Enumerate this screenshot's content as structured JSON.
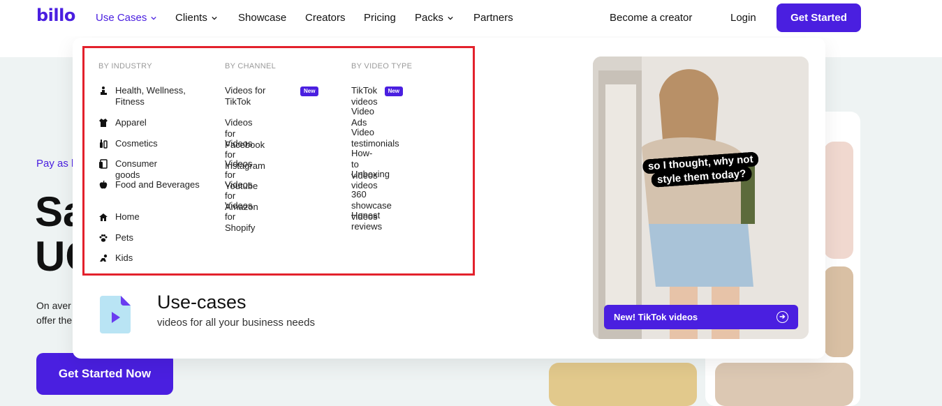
{
  "brand": {
    "logo": "billo",
    "accent": "#4a1fe0"
  },
  "nav": {
    "items": [
      {
        "label": "Use Cases",
        "dropdown": true,
        "active": true
      },
      {
        "label": "Clients",
        "dropdown": true
      },
      {
        "label": "Showcase"
      },
      {
        "label": "Creators"
      },
      {
        "label": "Pricing"
      },
      {
        "label": "Packs",
        "dropdown": true
      },
      {
        "label": "Partners"
      }
    ],
    "become_creator": "Become a creator",
    "login": "Login",
    "get_started": "Get Started"
  },
  "hero": {
    "kicker": "Pay as l",
    "title_line1": "Sa",
    "title_line2": "UC",
    "desc_line1": "On aver",
    "desc_line2": "offer the",
    "cta": "Get Started Now"
  },
  "dropdown": {
    "by_industry": {
      "heading": "BY INDUSTRY",
      "items": [
        {
          "label": "Health, Wellness, Fitness",
          "icon": "fitness-icon"
        },
        {
          "label": "Apparel",
          "icon": "apparel-icon"
        },
        {
          "label": "Cosmetics",
          "icon": "cosmetics-icon"
        },
        {
          "label": "Consumer goods",
          "icon": "consumer-goods-icon"
        },
        {
          "label": "Food and Beverages",
          "icon": "apple-icon"
        },
        {
          "label": "Home",
          "icon": "home-icon"
        },
        {
          "label": "Pets",
          "icon": "paw-icon"
        },
        {
          "label": "Kids",
          "icon": "kids-icon"
        }
      ]
    },
    "by_channel": {
      "heading": "BY CHANNEL",
      "items": [
        {
          "label": "Videos for TikTok",
          "badge": "New"
        },
        {
          "label": "Videos for Facebook"
        },
        {
          "label": "Videos for Instagram"
        },
        {
          "label": "Videos for Youtube"
        },
        {
          "label": "Videos for Amazon"
        },
        {
          "label": "Videos for Shopify"
        }
      ]
    },
    "by_video_type": {
      "heading": "BY VIDEO TYPE",
      "items": [
        {
          "label": "TikTok videos",
          "badge": "New"
        },
        {
          "label": "Video Ads"
        },
        {
          "label": "Video testimonials"
        },
        {
          "label": "How-to videos"
        },
        {
          "label": "Unboxing videos"
        },
        {
          "label": "360 showcase videos"
        },
        {
          "label": "Honest reviews"
        }
      ]
    },
    "usecases": {
      "title": "Use-cases",
      "subtitle": "videos for all your business needs"
    },
    "promo": {
      "caption": "so I thought, why not style them today?",
      "button": "New! TikTok videos"
    }
  }
}
